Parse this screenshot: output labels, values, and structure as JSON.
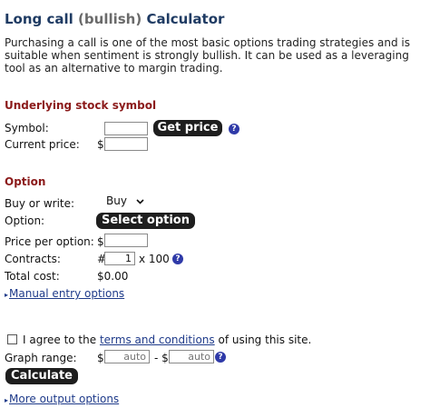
{
  "title": {
    "main": "Long call",
    "sub": "(bullish)",
    "tail": "Calculator"
  },
  "intro": "Purchasing a call is one of the most basic options trading strategies and is suitable when sentiment is strongly bullish. It can be used as a leveraging tool as an alternative to margin trading.",
  "underlying": {
    "heading": "Underlying stock symbol",
    "symbol_label": "Symbol:",
    "symbol_value": "",
    "get_price_label": "Get price",
    "current_price_label": "Current price:",
    "current_price_currency": "$",
    "current_price_value": ""
  },
  "option": {
    "heading": "Option",
    "buy_write_label": "Buy or write:",
    "buy_write_value": "Buy",
    "option_label": "Option:",
    "select_option_label": "Select option",
    "price_per_option_label": "Price per option:",
    "price_currency": "$",
    "price_value": "",
    "contracts_label": "Contracts:",
    "contracts_prefix": "#",
    "contracts_value": "1",
    "contracts_multiplier": "x 100",
    "total_cost_label": "Total cost:",
    "total_cost_value": "$0.00",
    "manual_entry_link": "Manual entry options"
  },
  "agree": {
    "prefix": "I agree to the",
    "link": "terms and conditions",
    "suffix": "of using this site."
  },
  "graph": {
    "range_label": "Graph range:",
    "currency": "$",
    "separator": "- $",
    "low_placeholder": "auto",
    "high_placeholder": "auto"
  },
  "calculate_label": "Calculate",
  "more_output_link": "More output options",
  "help_glyph": "?",
  "arrow_glyph": "▸",
  "colors": {
    "title": "#1f3b63",
    "section": "#8b1a1a",
    "link": "#1f3b8a",
    "help": "#2f3aa8",
    "button": "#1e1e1e"
  }
}
